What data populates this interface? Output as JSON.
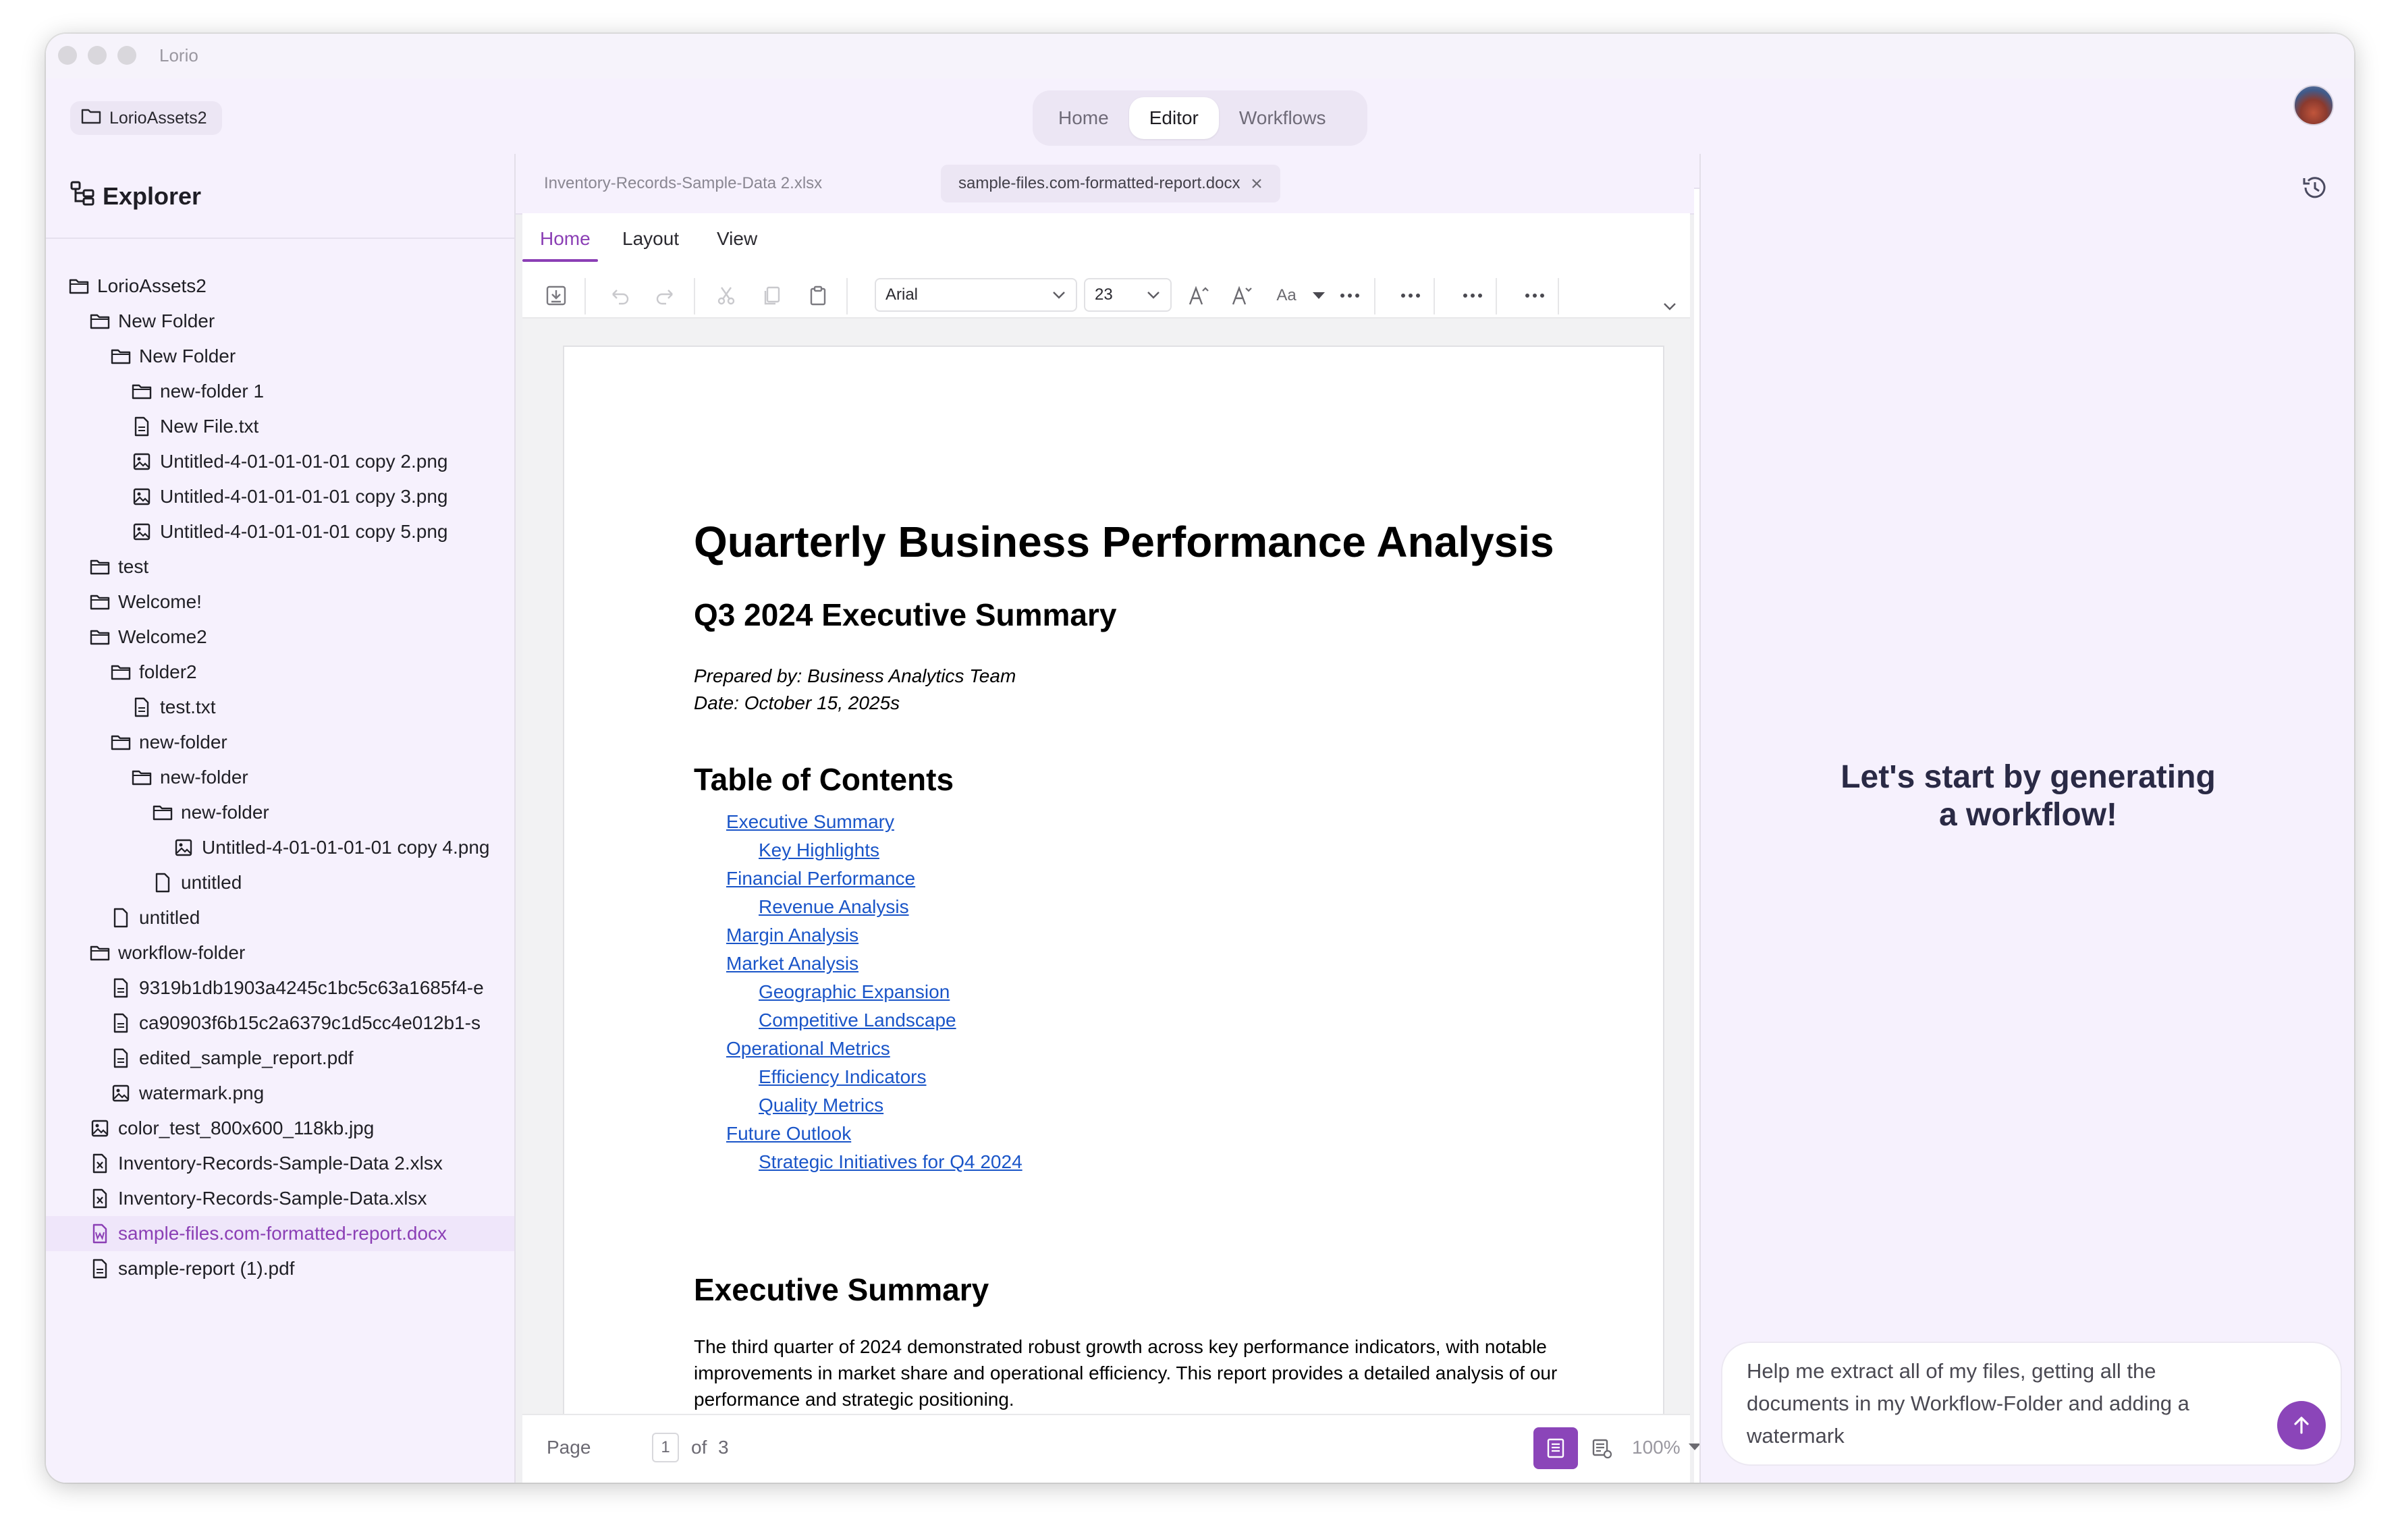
{
  "window": {
    "title": "Lorio"
  },
  "topbar": {
    "workspace": "LorioAssets2",
    "nav": [
      {
        "label": "Home"
      },
      {
        "label": "Editor"
      },
      {
        "label": "Workflows"
      }
    ],
    "active_nav": "Editor"
  },
  "sidebar": {
    "title": "Explorer",
    "tree": [
      {
        "label": "LorioAssets2",
        "type": "folder",
        "depth": 0
      },
      {
        "label": "New Folder",
        "type": "folder",
        "depth": 1
      },
      {
        "label": "New Folder",
        "type": "folder",
        "depth": 2
      },
      {
        "label": "new-folder 1",
        "type": "folder",
        "depth": 3
      },
      {
        "label": "New File.txt",
        "type": "text",
        "depth": 3
      },
      {
        "label": "Untitled-4-01-01-01-01 copy 2.png",
        "type": "image",
        "depth": 3
      },
      {
        "label": "Untitled-4-01-01-01-01 copy 3.png",
        "type": "image",
        "depth": 3
      },
      {
        "label": "Untitled-4-01-01-01-01 copy 5.png",
        "type": "image",
        "depth": 3
      },
      {
        "label": "test",
        "type": "folder",
        "depth": 1
      },
      {
        "label": "Welcome!",
        "type": "folder",
        "depth": 1
      },
      {
        "label": "Welcome2",
        "type": "folder",
        "depth": 1
      },
      {
        "label": "folder2",
        "type": "folder",
        "depth": 2
      },
      {
        "label": "test.txt",
        "type": "text",
        "depth": 3
      },
      {
        "label": "new-folder",
        "type": "folder",
        "depth": 2
      },
      {
        "label": "new-folder",
        "type": "folder",
        "depth": 3
      },
      {
        "label": "new-folder",
        "type": "folder",
        "depth": 4
      },
      {
        "label": "Untitled-4-01-01-01-01 copy 4.png",
        "type": "image",
        "depth": 5
      },
      {
        "label": "untitled",
        "type": "file",
        "depth": 4
      },
      {
        "label": "untitled",
        "type": "file",
        "depth": 2
      },
      {
        "label": "workflow-folder",
        "type": "folder",
        "depth": 1
      },
      {
        "label": "9319b1db1903a4245c1bc5c63a1685f4-e",
        "type": "text",
        "depth": 2
      },
      {
        "label": "ca90903f6b15c2a6379c1d5cc4e012b1-s",
        "type": "text",
        "depth": 2
      },
      {
        "label": "edited_sample_report.pdf",
        "type": "text",
        "depth": 2
      },
      {
        "label": "watermark.png",
        "type": "image",
        "depth": 2
      },
      {
        "label": "color_test_800x600_118kb.jpg",
        "type": "image",
        "depth": 1
      },
      {
        "label": "Inventory-Records-Sample-Data 2.xlsx",
        "type": "sheet",
        "depth": 1
      },
      {
        "label": "Inventory-Records-Sample-Data.xlsx",
        "type": "sheet",
        "depth": 1
      },
      {
        "label": "sample-files.com-formatted-report.docx",
        "type": "doc",
        "depth": 1,
        "selected": true
      },
      {
        "label": "sample-report (1).pdf",
        "type": "text",
        "depth": 1
      }
    ]
  },
  "editor": {
    "tabs": [
      {
        "label": "Inventory-Records-Sample-Data 2.xlsx",
        "active": false
      },
      {
        "label": "sample-files.com-formatted-report.docx",
        "active": true
      }
    ],
    "ribbon_tabs": [
      "Home",
      "Layout",
      "View"
    ],
    "font_family": "Arial",
    "font_size": "23",
    "case_label": "Aa",
    "page_label": "Page",
    "page_current": "1",
    "page_of": "of",
    "page_total": "3",
    "zoom": "100%"
  },
  "document": {
    "title": "Quarterly Business Performance Analysis",
    "subtitle": "Q3 2024 Executive Summary",
    "prepared_by": "Prepared by: Business Analytics Team",
    "date": "Date: October 15, 2025s",
    "toc_heading": "Table of Contents",
    "toc": [
      {
        "label": "Executive Summary",
        "level": 1
      },
      {
        "label": "Key Highlights",
        "level": 2
      },
      {
        "label": "Financial Performance",
        "level": 1
      },
      {
        "label": "Revenue Analysis",
        "level": 2
      },
      {
        "label": "Margin Analysis",
        "level": 1
      },
      {
        "label": "Market Analysis",
        "level": 1
      },
      {
        "label": "Geographic Expansion",
        "level": 2
      },
      {
        "label": "Competitive Landscape",
        "level": 2
      },
      {
        "label": "Operational Metrics",
        "level": 1
      },
      {
        "label": "Efficiency Indicators",
        "level": 2
      },
      {
        "label": "Quality Metrics",
        "level": 2
      },
      {
        "label": "Future Outlook",
        "level": 1
      },
      {
        "label": "Strategic Initiatives for Q4 2024",
        "level": 2
      }
    ],
    "section_heading": "Executive Summary",
    "section_body": "The third quarter of 2024 demonstrated robust growth across key performance indicators, with notable improvements in market share and operational efficiency. This report provides a detailed analysis of our performance and strategic positioning."
  },
  "assistant": {
    "empty_message": "Let's start by generating a workflow!",
    "prompt": "Help me extract all of my files, getting all the documents in my Workflow-Folder and adding a watermark"
  },
  "colors": {
    "accent": "#8b45b9",
    "link": "#1a55c8",
    "sidebar_bg": "#f6f1fd"
  }
}
